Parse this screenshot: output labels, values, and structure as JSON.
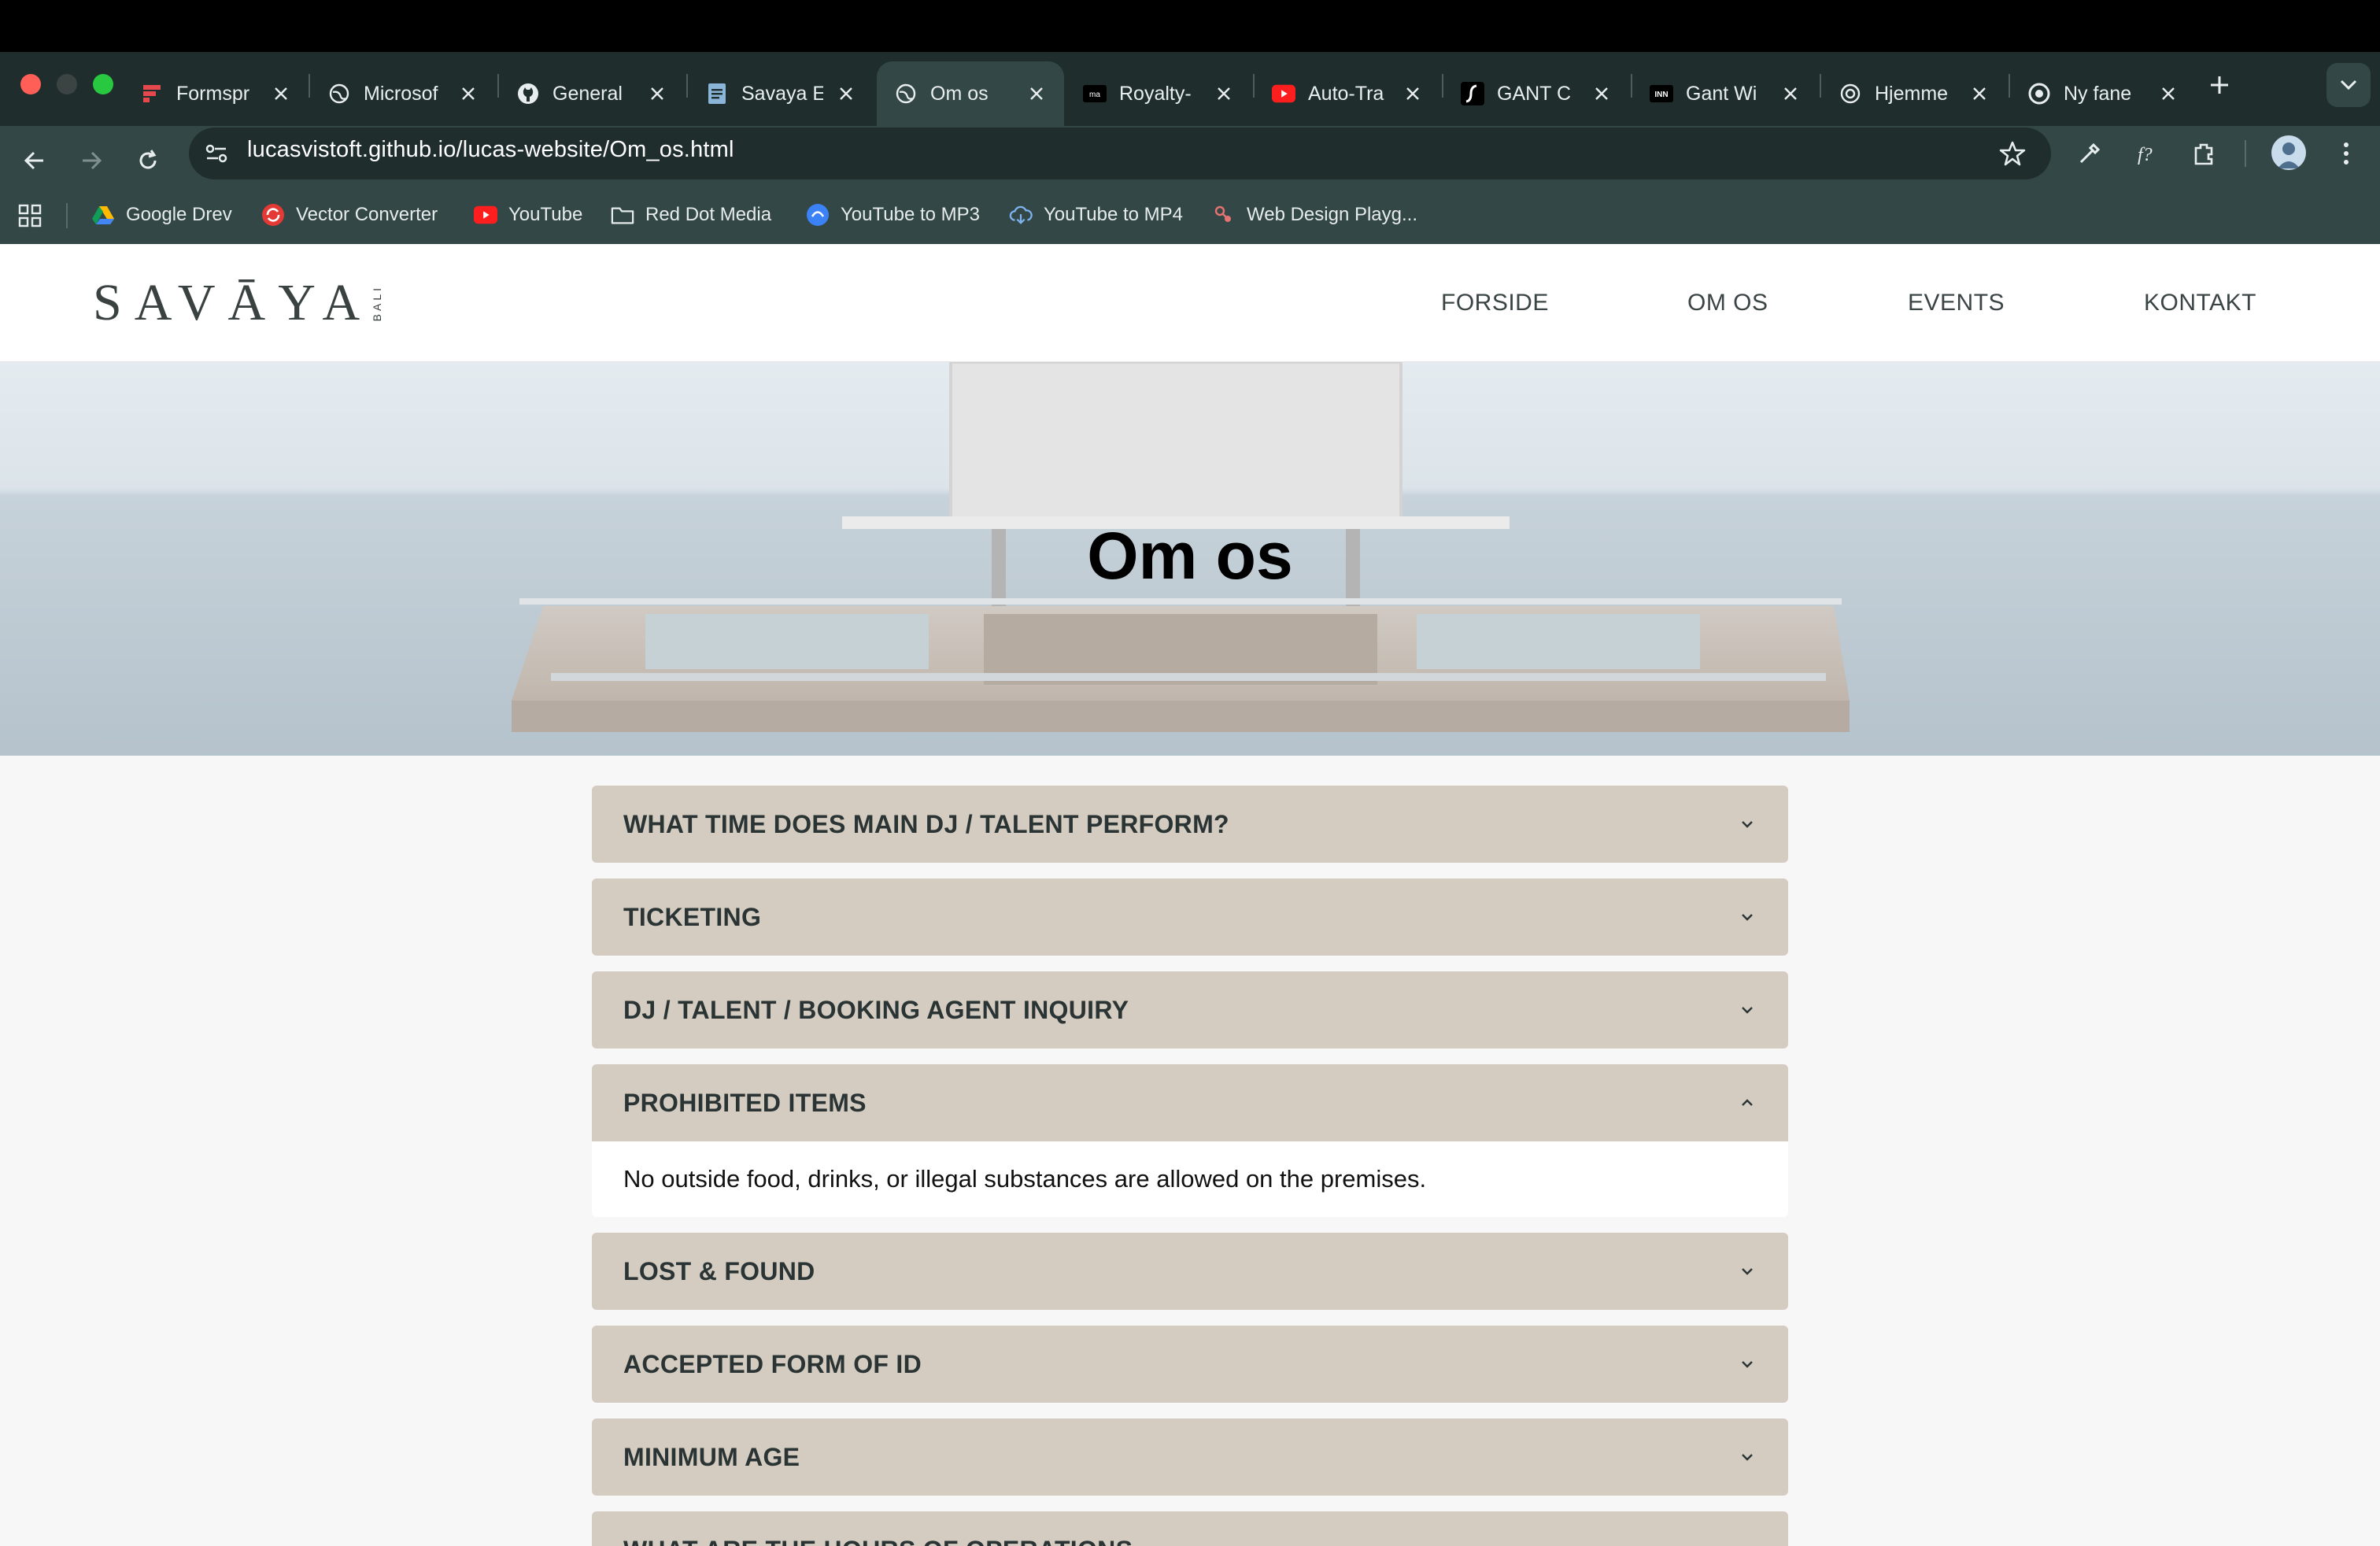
{
  "browser": {
    "tabs": [
      {
        "title": "Formspr",
        "icon": "formspree-icon"
      },
      {
        "title": "Microsof",
        "icon": "globe-icon"
      },
      {
        "title": "General",
        "icon": "github-icon"
      },
      {
        "title": "Savaya E",
        "icon": "document-icon"
      },
      {
        "title": "Om os",
        "icon": "globe-icon",
        "active": true
      },
      {
        "title": "Royalty-",
        "icon": "site-icon"
      },
      {
        "title": "Auto-Tra",
        "icon": "youtube-icon"
      },
      {
        "title": "GANT C",
        "icon": "gant-icon"
      },
      {
        "title": "Gant Wi",
        "icon": "site-icon"
      },
      {
        "title": "Hjemme",
        "icon": "chatgpt-icon"
      },
      {
        "title": "Ny fane",
        "icon": "chrome-icon"
      }
    ],
    "url": "lucasvistoft.github.io/lucas-website/Om_os.html",
    "bookmarks": [
      {
        "label": "Google Drev",
        "icon": "google-drive-icon"
      },
      {
        "label": "Vector Converter",
        "icon": "converter-icon"
      },
      {
        "label": "YouTube",
        "icon": "youtube-icon"
      },
      {
        "label": "Red Dot Media",
        "icon": "folder-icon"
      },
      {
        "label": "YouTube to MP3",
        "icon": "mp3-icon"
      },
      {
        "label": "YouTube to MP4",
        "icon": "cloud-download-icon"
      },
      {
        "label": "Web Design Playg...",
        "icon": "playground-icon"
      }
    ]
  },
  "site": {
    "logo": "SAVĀYA",
    "logo_sub": "BALI",
    "nav": [
      "FORSIDE",
      "OM OS",
      "EVENTS",
      "KONTAKT"
    ],
    "hero_title": "Om os"
  },
  "faq": [
    {
      "q": "WHAT TIME DOES MAIN DJ / TALENT PERFORM?",
      "open": false
    },
    {
      "q": "TICKETING",
      "open": false
    },
    {
      "q": "DJ / TALENT / BOOKING AGENT INQUIRY",
      "open": false
    },
    {
      "q": "PROHIBITED ITEMS",
      "open": true,
      "a": "No outside food, drinks, or illegal substances are allowed on the premises."
    },
    {
      "q": "LOST & FOUND",
      "open": false
    },
    {
      "q": "ACCEPTED FORM OF ID",
      "open": false
    },
    {
      "q": "MINIMUM AGE",
      "open": false
    },
    {
      "q": "WHAT ARE THE HOURS OF OPERATIONS",
      "open": false
    }
  ]
}
